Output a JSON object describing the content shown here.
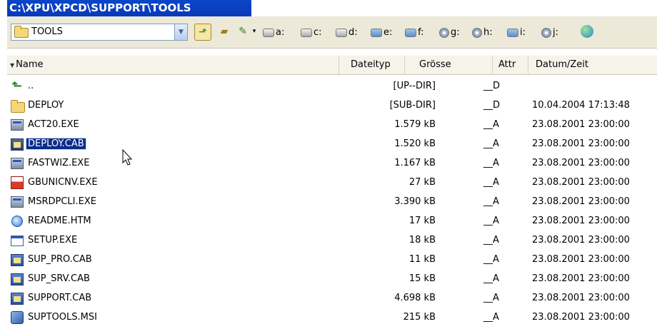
{
  "window": {
    "title": "C:\\XPU\\XPCD\\SUPPORT\\TOOLS"
  },
  "toolbar": {
    "current_folder": "TOOLS",
    "dropdown_arrow": "▼",
    "drives": [
      "a:",
      "c:",
      "d:",
      "e:",
      "f:",
      "g:",
      "h:",
      "i:",
      "j:"
    ]
  },
  "columns": {
    "name": "Name",
    "type": "Dateityp",
    "size": "Grösse",
    "attr": "Attr",
    "date": "Datum/Zeit",
    "sort_indicator": "▼"
  },
  "files": [
    {
      "name": "..",
      "type": "",
      "size": "[UP--DIR]",
      "attr": "__D",
      "date": "",
      "icon": "up-arrow-icon"
    },
    {
      "name": "DEPLOY",
      "type": "",
      "size": "[SUB-DIR]",
      "attr": "__D",
      "date": "10.04.2004 17:13:48",
      "icon": "folder-icon"
    },
    {
      "name": "ACT20.EXE",
      "type": "",
      "size": "1.579 kB",
      "attr": "__A",
      "date": "23.08.2001 23:00:00",
      "icon": "exe-icon"
    },
    {
      "name": "DEPLOY.CAB",
      "type": "",
      "size": "1.520 kB",
      "attr": "__A",
      "date": "23.08.2001 23:00:00",
      "icon": "cab-icon",
      "selected": true
    },
    {
      "name": "FASTWIZ.EXE",
      "type": "",
      "size": "1.167 kB",
      "attr": "__A",
      "date": "23.08.2001 23:00:00",
      "icon": "exe-icon"
    },
    {
      "name": "GBUNICNV.EXE",
      "type": "",
      "size": "27 kB",
      "attr": "__A",
      "date": "23.08.2001 23:00:00",
      "icon": "gb-exe-icon"
    },
    {
      "name": "MSRDPCLI.EXE",
      "type": "",
      "size": "3.390 kB",
      "attr": "__A",
      "date": "23.08.2001 23:00:00",
      "icon": "exe-icon"
    },
    {
      "name": "README.HTM",
      "type": "",
      "size": "17 kB",
      "attr": "__A",
      "date": "23.08.2001 23:00:00",
      "icon": "htm-icon"
    },
    {
      "name": "SETUP.EXE",
      "type": "",
      "size": "18 kB",
      "attr": "__A",
      "date": "23.08.2001 23:00:00",
      "icon": "setup-icon"
    },
    {
      "name": "SUP_PRO.CAB",
      "type": "",
      "size": "11 kB",
      "attr": "__A",
      "date": "23.08.2001 23:00:00",
      "icon": "cab-icon"
    },
    {
      "name": "SUP_SRV.CAB",
      "type": "",
      "size": "15 kB",
      "attr": "__A",
      "date": "23.08.2001 23:00:00",
      "icon": "cab-icon"
    },
    {
      "name": "SUPPORT.CAB",
      "type": "",
      "size": "4.698 kB",
      "attr": "__A",
      "date": "23.08.2001 23:00:00",
      "icon": "cab-icon"
    },
    {
      "name": "SUPTOOLS.MSI",
      "type": "",
      "size": "215 kB",
      "attr": "__A",
      "date": "23.08.2001 23:00:00",
      "icon": "msi-icon"
    }
  ],
  "colors": {
    "title_bar": "#0a46c9",
    "selection": "#0b2d8a",
    "toolbar_bg": "#ece9d8"
  }
}
